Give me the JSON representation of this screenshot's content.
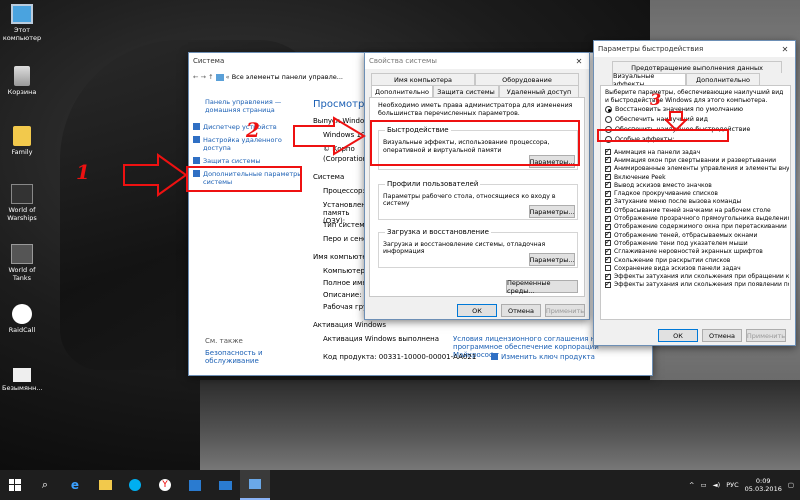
{
  "desktop": {
    "icons": [
      {
        "label": "Этот компьютер",
        "icon": "computer-icon"
      },
      {
        "label": "Корзина",
        "icon": "recycle-bin-icon"
      },
      {
        "label": "Family",
        "icon": "folder-icon"
      },
      {
        "label": "World of Warships",
        "icon": "warships-icon"
      },
      {
        "label": "World of Tanks",
        "icon": "tanks-icon"
      },
      {
        "label": "RaidCall",
        "icon": "raidcall-icon"
      },
      {
        "label": "Безымянн...",
        "icon": "file-icon"
      }
    ]
  },
  "system_window": {
    "title": "Система",
    "address": "Все элементы панели управле...",
    "sidebar": {
      "home": "Панель управления — домашняя страница",
      "links": [
        "Диспетчер устройств",
        "Настройка удаленного доступа",
        "Защита системы",
        "Дополнительные параметры системы"
      ],
      "see_also": "См. также",
      "security": "Безопасность и обслуживание"
    },
    "main": {
      "heading": "Просмотр о",
      "edition_label": "Выпуск Window",
      "edition": "Windows 10",
      "copyright": "© Корпо",
      "copyright2": "(Corporation)",
      "system_section": "Система",
      "rows": [
        "Процессор:",
        "Установленная память (ОЗУ):",
        "Тип системы:",
        "Перо и сенсо"
      ],
      "computer_section": "Имя компьютера",
      "computer_rows": [
        "Компьютер:",
        "Полное имя",
        "Описание:",
        "Рабочая груп"
      ],
      "activation_section": "Активация Windows",
      "activation_text": "Активация Windows выполнена",
      "license_link": "Условия лицензионного соглашения на программное обеспечение корпорации Майкрософт",
      "product_id": "Код продукта: 00331-10000-00001-AA021",
      "change_key": "Изменить ключ продукта"
    }
  },
  "props_window": {
    "title": "Свойства системы",
    "tabs_top": [
      "Имя компьютера",
      "Оборудование"
    ],
    "tabs_bottom": [
      "Дополнительно",
      "Защита системы",
      "Удаленный доступ"
    ],
    "admin_note": "Необходимо иметь права администратора для изменения большинства перечисленных параметров.",
    "groups": [
      {
        "title": "Быстродействие",
        "text": "Визуальные эффекты, использование процессора, оперативной и виртуальной памяти",
        "button": "Параметры..."
      },
      {
        "title": "Профили пользователей",
        "text": "Параметры рабочего стола, относящиеся ко входу в систему",
        "button": "Параметры..."
      },
      {
        "title": "Загрузка и восстановление",
        "text": "Загрузка и восстановление системы, отладочная информация",
        "button": "Параметры..."
      }
    ],
    "env_button": "Переменные среды...",
    "ok": "ОК",
    "cancel": "Отмена",
    "apply": "Применить"
  },
  "perf_window": {
    "title": "Параметры быстродействия",
    "tab_dep": "Предотвращение выполнения данных",
    "tab_visual": "Визуальные эффекты",
    "tab_advanced": "Дополнительно",
    "intro": "Выберите параметры, обеспечивающие наилучший вид и быстродействие Windows для этого компьютера.",
    "radios": [
      {
        "label": "Восстановить значения по умолчанию",
        "on": true
      },
      {
        "label": "Обеспечить наилучший вид",
        "on": false
      },
      {
        "label": "Обеспечить наилучшее быстродействие",
        "on": false
      },
      {
        "label": "Особые эффекты:",
        "on": false
      }
    ],
    "effects": [
      {
        "label": "Анимация на панели задач",
        "on": true
      },
      {
        "label": "Анимация окон при свертывании и развертывании",
        "on": true
      },
      {
        "label": "Анимированные элементы управления и элементы внутри",
        "on": true
      },
      {
        "label": "Включение Peek",
        "on": true
      },
      {
        "label": "Вывод эскизов вместо значков",
        "on": true
      },
      {
        "label": "Гладкое прокручивание списков",
        "on": true
      },
      {
        "label": "Затухание меню после вызова команды",
        "on": true
      },
      {
        "label": "Отбрасывание теней значками на рабочем столе",
        "on": true
      },
      {
        "label": "Отображение прозрачного прямоугольника выделения",
        "on": true
      },
      {
        "label": "Отображение содержимого окна при перетаскивании",
        "on": true
      },
      {
        "label": "Отображение теней, отбрасываемых окнами",
        "on": true
      },
      {
        "label": "Отображение тени под указателем мыши",
        "on": true
      },
      {
        "label": "Сглаживание неровностей экранных шрифтов",
        "on": true
      },
      {
        "label": "Скольжение при раскрытии списков",
        "on": true
      },
      {
        "label": "Сохранение вида эскизов панели задач",
        "on": false
      },
      {
        "label": "Эффекты затухания или скольжения при обращении к ме",
        "on": true
      },
      {
        "label": "Эффекты затухания или скольжения при появлении подс",
        "on": true
      }
    ],
    "ok": "ОК",
    "cancel": "Отмена",
    "apply": "Применить"
  },
  "annotations": {
    "n1": "1",
    "n2": "2",
    "n3": "3"
  },
  "taskbar": {
    "lang": "РУС",
    "time": "0:09",
    "date": "05.03.2016"
  }
}
